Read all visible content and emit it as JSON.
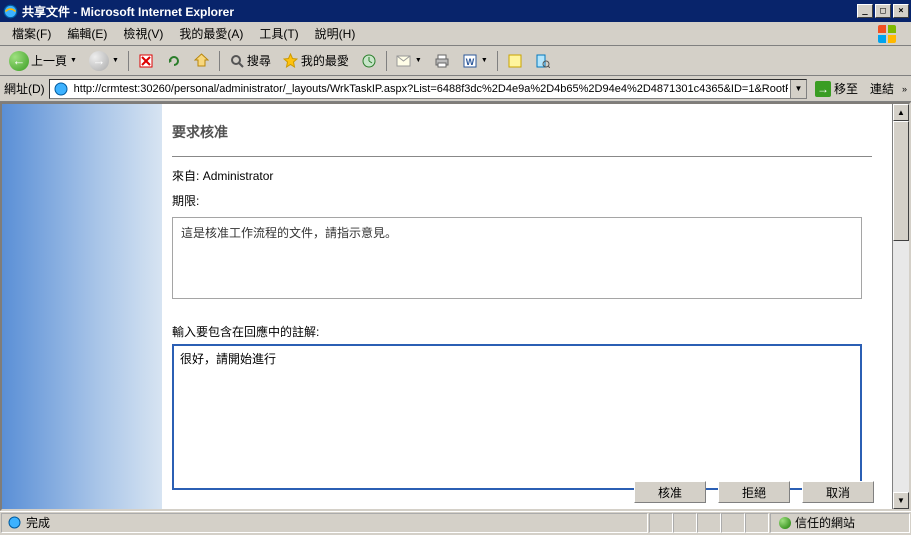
{
  "window": {
    "title": "共享文件 - Microsoft Internet Explorer",
    "min": "_",
    "max": "□",
    "close": "×"
  },
  "menu": {
    "file": "檔案(F)",
    "edit": "編輯(E)",
    "view": "檢視(V)",
    "favorites": "我的最愛(A)",
    "tools": "工具(T)",
    "help": "說明(H)"
  },
  "toolbar": {
    "back": "上一頁",
    "search": "搜尋",
    "favorites": "我的最愛"
  },
  "address": {
    "label": "網址(D)",
    "url": "http://crmtest:30260/personal/administrator/_layouts/WrkTaskIP.aspx?List=6488f3dc%2D4e9a%2D4b65%2D94e4%2D4871301c4365&ID=1&RootF",
    "go": "移至",
    "links": "連結",
    "chev": "»"
  },
  "page": {
    "title": "要求核准",
    "from_label": "來自:",
    "from_value": "Administrator",
    "deadline_label": "期限:",
    "deadline_value": "",
    "description": "這是核准工作流程的文件，請指示意見。",
    "comment_label": "輸入要包含在回應中的註解:",
    "comment_value": "很好，請開始進行",
    "approve": "核准",
    "reject": "拒絕",
    "cancel": "取消"
  },
  "status": {
    "done": "完成",
    "zone": "信任的網站"
  }
}
